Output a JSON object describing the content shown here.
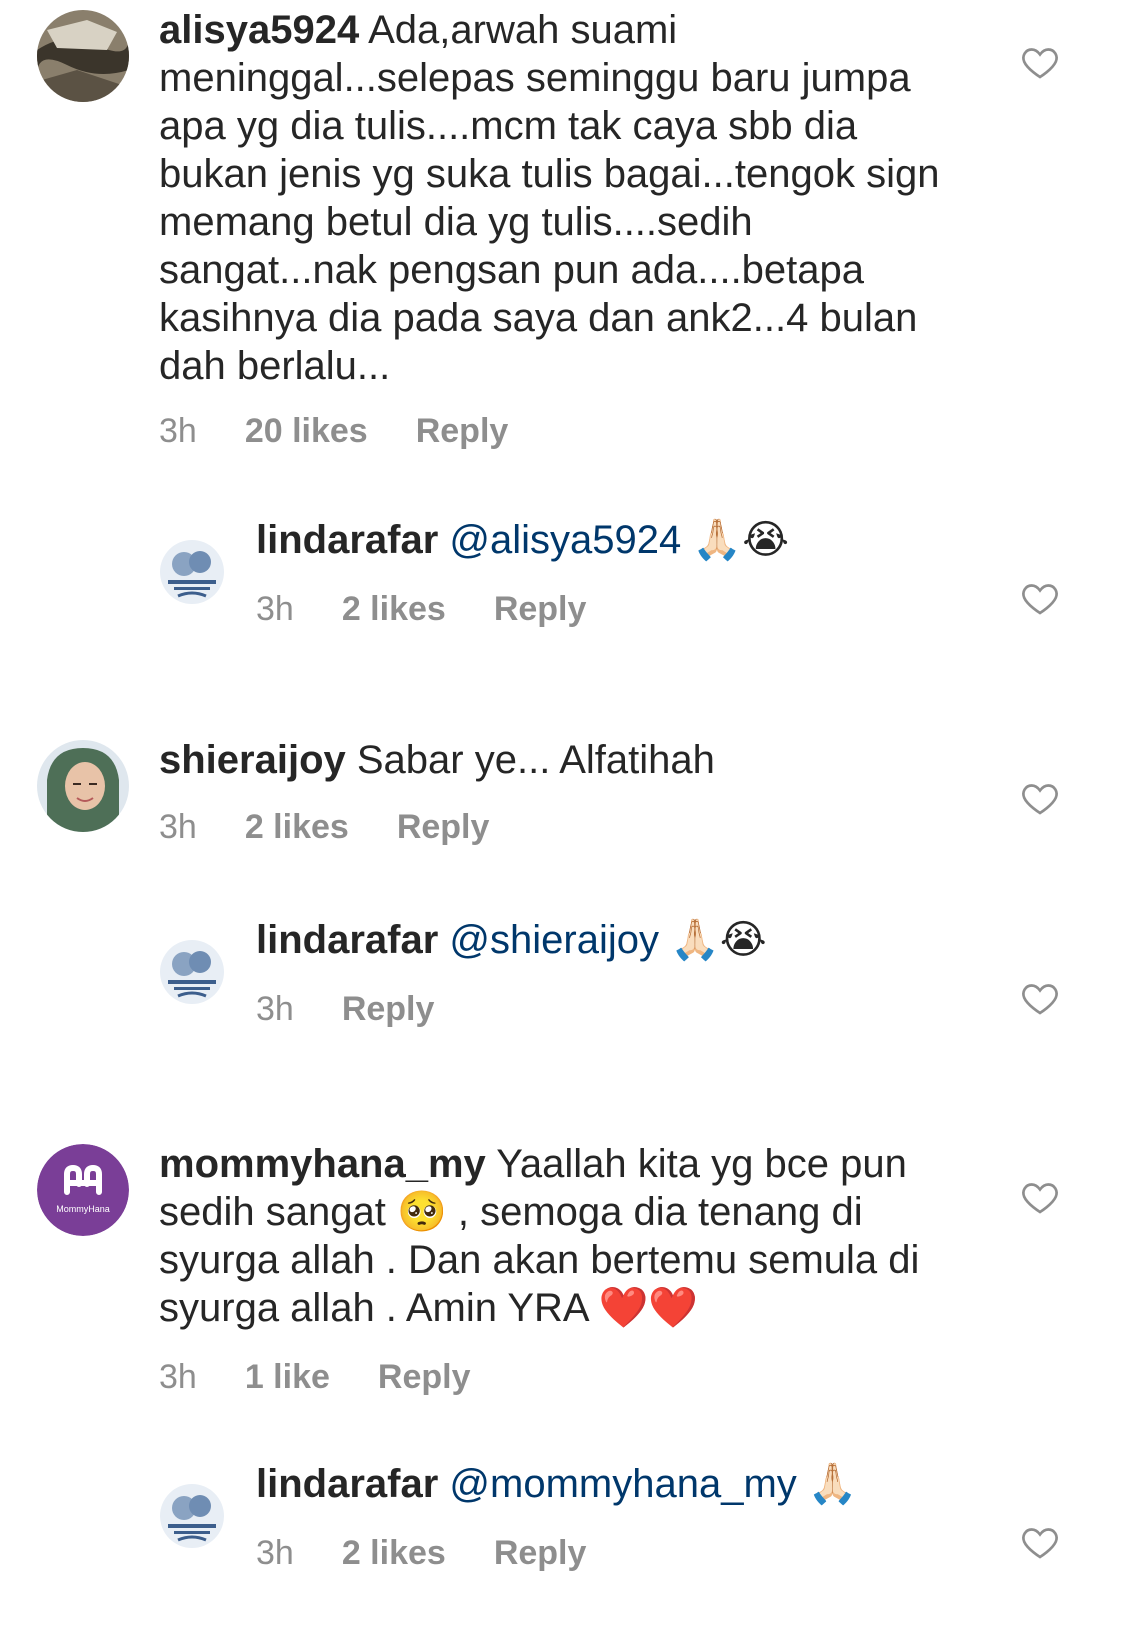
{
  "comments": [
    {
      "username": "alisya5924",
      "text": " Ada,arwah suami meninggal...selepas seminggu baru jumpa apa yg dia tulis....mcm tak caya sbb dia bukan jenis yg suka tulis bagai...tengok sign memang betul dia yg tulis....sedih sangat...nak pengsan pun ada....betapa kasihnya dia pada saya dan ank2...4 bulan dah berlalu...",
      "time": "3h",
      "likes": "20 likes",
      "reply_label": "Reply"
    },
    {
      "username": "lindarafar",
      "mention": "@alisya5924",
      "emoji": "🙏🏻😭",
      "time": "3h",
      "likes": "2 likes",
      "reply_label": "Reply"
    },
    {
      "username": "shieraijoy",
      "text": " Sabar ye... Alfatihah",
      "time": "3h",
      "likes": "2 likes",
      "reply_label": "Reply"
    },
    {
      "username": "lindarafar",
      "mention": "@shieraijoy",
      "emoji": "🙏🏻😭",
      "time": "3h",
      "reply_label": "Reply"
    },
    {
      "username": "mommyhana_my",
      "text": " Yaallah kita yg bce pun sedih sangat 🥺 , semoga dia tenang di syurga allah . Dan akan bertemu semula di syurga allah . Amin YRA ❤️❤️",
      "time": "3h",
      "likes": "1 like",
      "reply_label": "Reply"
    },
    {
      "username": "lindarafar",
      "mention": "@mommyhana_my",
      "emoji": "🙏🏻",
      "time": "3h",
      "likes": "2 likes",
      "reply_label": "Reply"
    }
  ],
  "avatar_labels": {
    "mommyhana": "MommyHana"
  },
  "colors": {
    "text": "#262626",
    "meta": "#8e8e8e",
    "mention": "#00376b",
    "mommyhana_brand": "#7a3e97"
  }
}
